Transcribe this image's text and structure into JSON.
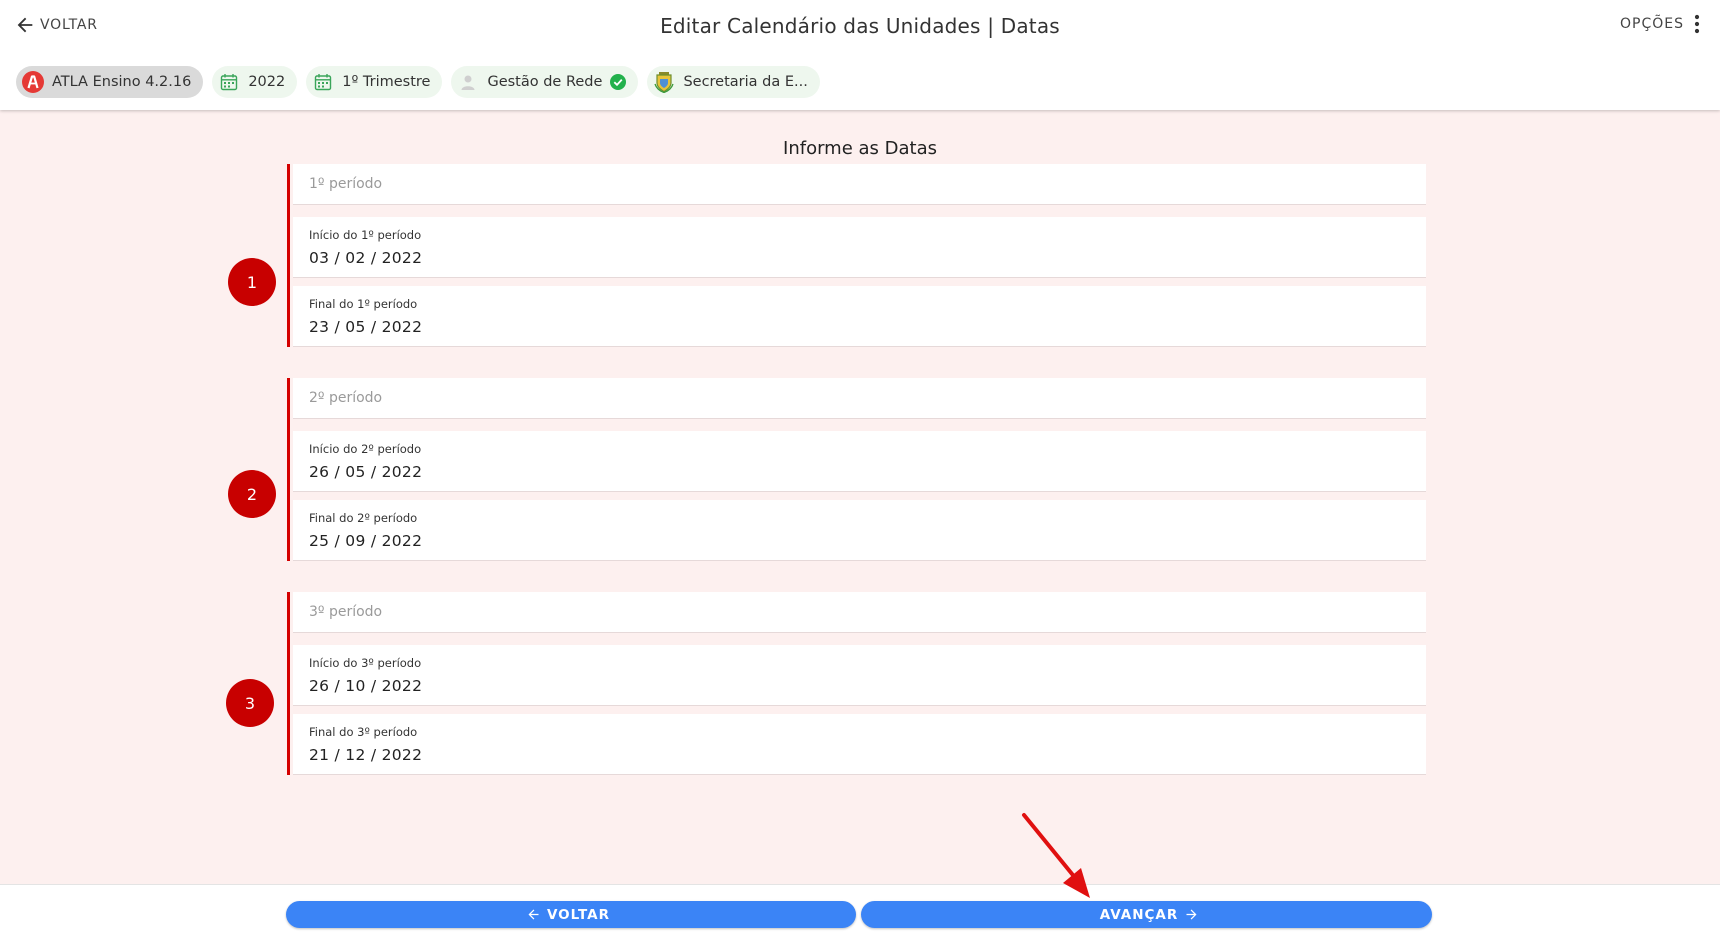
{
  "header": {
    "back_label": "VOLTAR",
    "title": "Editar Calendário das Unidades | Datas",
    "options_label": "OPÇÕES"
  },
  "chips": [
    {
      "label": "ATLA Ensino 4.2.16",
      "icon": "atla-logo-icon"
    },
    {
      "label": "2022",
      "icon": "calendar-icon"
    },
    {
      "label": "1º Trimestre",
      "icon": "calendar-icon"
    },
    {
      "label": "Gestão de Rede",
      "icon": "person-icon",
      "badge": "check-circle-icon"
    },
    {
      "label": "Secretaria da E...",
      "icon": "municipal-crest-icon"
    }
  ],
  "section_title": "Informe as Datas",
  "periods": [
    {
      "marker": "1",
      "placeholder": "1º período",
      "start_label": "Início do 1º período",
      "start_value": "03 / 02 / 2022",
      "end_label": "Final do 1º período",
      "end_value": "23 / 05 / 2022"
    },
    {
      "marker": "2",
      "placeholder": "2º período",
      "start_label": "Início do 2º período",
      "start_value": "26 / 05 / 2022",
      "end_label": "Final do 2º período",
      "end_value": "25 / 09 / 2022"
    },
    {
      "marker": "3",
      "placeholder": "3º período",
      "start_label": "Início do 3º período",
      "start_value": "26 / 10 / 2022",
      "end_label": "Final do 3º período",
      "end_value": "21 / 12 / 2022"
    }
  ],
  "footer": {
    "back_label": "VOLTAR",
    "next_label": "AVANÇAR"
  },
  "colors": {
    "accent_red": "#d40000",
    "marker_red": "#c80000",
    "button_blue": "#3b84f6",
    "background_pink": "#fdf0ef",
    "chip_mint": "#eef7ee",
    "check_green": "#22b14c"
  }
}
